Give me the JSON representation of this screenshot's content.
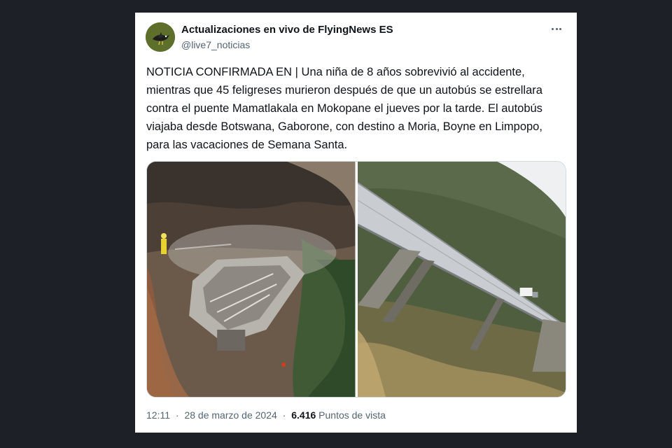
{
  "tweet": {
    "author_name": "Actualizaciones en vivo de FlyingNews ES",
    "handle": "@live7_noticias",
    "text": "NOTICIA CONFIRMADA EN | Una niña de 8 años sobrevivió al accidente, mientras que 45 feligreses murieron después de que un autobús se estrellara contra el puente Mamatlakala en Mokopane el jueves por la tarde. El autobús viajaba desde Botswana, Gaborone, con destino a Moria, Boyne en Limpopo, para las vacaciones de Semana Santa.",
    "time": "12:11",
    "separator": "·",
    "date": "28 de marzo de 2024",
    "views_count": "6.416",
    "views_label": "Puntos de vista"
  },
  "icons": {
    "more": "more-dots-icon",
    "avatar": "bird-avatar"
  },
  "colors": {
    "background": "#1e2028",
    "card": "#ffffff",
    "text_primary": "#0f1419",
    "text_secondary": "#536471",
    "avatar_bg": "#5a6b2a"
  }
}
